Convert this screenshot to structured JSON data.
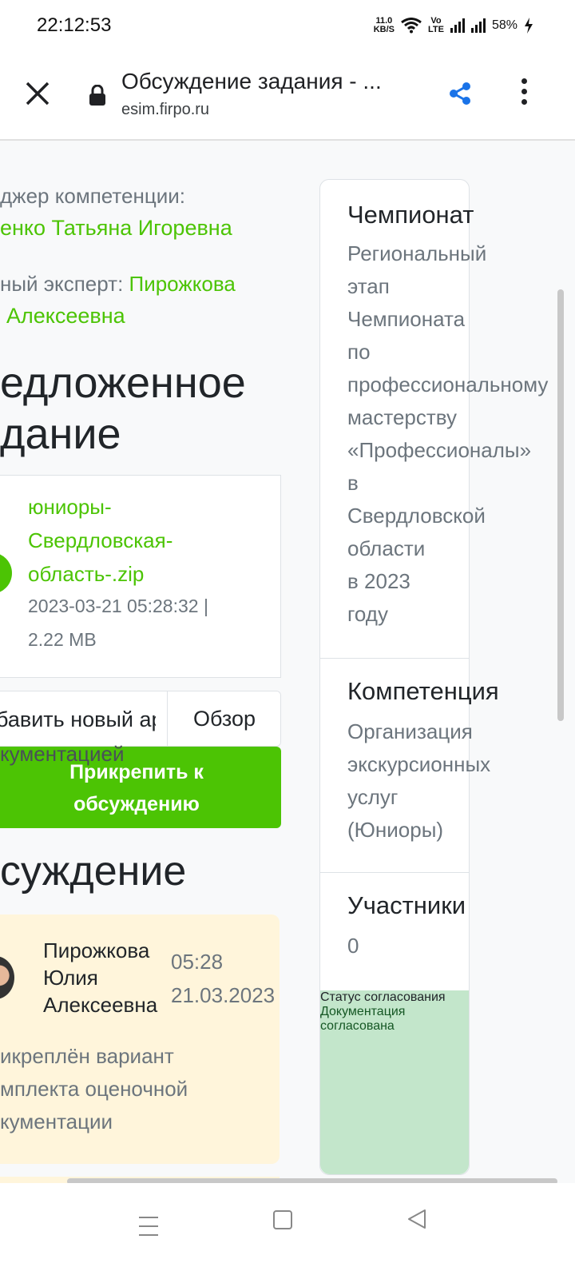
{
  "status_bar": {
    "time": "22:12:53",
    "net_speed_top": "11.0",
    "net_speed_unit": "KB/S",
    "volte_top": "Vo",
    "volte_bottom": "LTE",
    "battery": "58%"
  },
  "browser": {
    "title": "Обсуждение задания - ...",
    "url": "esim.firpo.ru"
  },
  "left": {
    "manager_label": "джер компетенции:",
    "manager_name": "енко Татьяна Игоревна",
    "expert_label": "ный эксперт: ",
    "expert_name_part1": "Пирожкова",
    "expert_name_part2": "Алексеевна",
    "proposed_heading_line1": "едложенное",
    "proposed_heading_line2": "дание",
    "file": {
      "name_line1": "юниоры-",
      "name_line2": "Свердловская-",
      "name_line3": "область-.zip",
      "meta_line1": "2023-03-21 05:28:32 |",
      "meta_line2": "2.22 MB"
    },
    "file_input_placeholder": "бавить новый архив",
    "browse_label": "Обзор",
    "overflow_text": "кументацией",
    "attach_button_line1": "Прикрепить к",
    "attach_button_line2": "обсуждению",
    "discussion_heading": "суждение",
    "message": {
      "author_line1": "Пирожкова",
      "author_line2": "Юлия",
      "author_line3": "Алексеевна",
      "time": "05:28",
      "date": "21.03.2023",
      "text_line1": "икреплён вариант",
      "text_line2": "мплекта оценочной",
      "text_line3": "кументации"
    }
  },
  "right": {
    "championship_label": "Чемпионат",
    "championship_lines": [
      "Региональный",
      "этап",
      "Чемпионата",
      "по",
      "профессиональному",
      "мастерству",
      "«Профессионалы»",
      "в",
      "Свердловской",
      "области",
      "в 2023",
      "году"
    ],
    "competence_label": "Компетенция",
    "competence_lines": [
      "Организация",
      "экскурсионных",
      "услуг",
      "(Юниоры)"
    ],
    "participants_label": "Участники",
    "participants_value": "0",
    "status_label_line1": "Статус",
    "status_label_line2": "согласования",
    "status_value_line1": "Документация",
    "status_value_line2": "согласована"
  },
  "colors": {
    "accent_green": "#4cc404",
    "status_green_bg": "#c3e6cb",
    "status_green_text": "#155724",
    "message_bg": "#fff5db",
    "share_blue": "#1a73e8"
  }
}
